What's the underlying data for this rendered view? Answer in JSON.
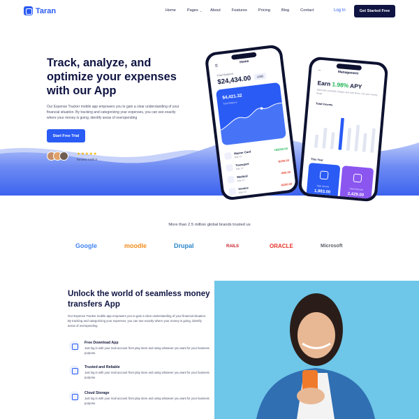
{
  "nav": {
    "brand": "Taran",
    "links": [
      "Home",
      "Pages",
      "About",
      "Features",
      "Pricing",
      "Blog",
      "Contact"
    ],
    "login": "Log In",
    "cta": "Get Started Free"
  },
  "hero": {
    "title": "Track, analyze, and optimize your expenses with our App",
    "description": "Our Expense Tracker mobile app empowers you to gain a clear understanding of your financial situation. By tracking and categorizing your expenses, you can see exactly where your money is going, identify areas of overspending",
    "button": "Start Free Trial",
    "stars": "★★★★★",
    "review": "Review 4.8/5.0"
  },
  "phone1": {
    "title": "Home",
    "total_label": "Total Balance",
    "balance": "$24,434.00",
    "currency": "USD",
    "card_value": "$4,421.32",
    "card_label": "Total Balance",
    "transactions": [
      {
        "name": "Master Card",
        "sub": "Mar 12",
        "amount": "+$2000.00",
        "color": "#1fb554"
      },
      {
        "name": "Transport",
        "sub": "Mar 12",
        "amount": "-$190.00",
        "color": "#e5412d"
      },
      {
        "name": "Medical",
        "sub": "Mar 11",
        "amount": "-$50.00",
        "color": "#e5412d"
      },
      {
        "name": "Invoice",
        "sub": "Mar 10",
        "amount": "-$200.00",
        "color": "#e5412d"
      }
    ]
  },
  "phone2": {
    "title": "Management",
    "earn_prefix": "Earn ",
    "earn_rate": "1.98%",
    "earn_suffix": " APY",
    "earn_sub": "Eliminate overdraft charges and wait times. Get your money faster.",
    "income_label": "Total Income",
    "income_range": "This Year",
    "bars": [
      0.35,
      0.55,
      0.45,
      0.85,
      0.6,
      0.7,
      0.5,
      0.65
    ],
    "box1_label": "Total Income",
    "box1_value": "1,983.00",
    "box2_label": "Total Expense",
    "box2_value": "2,429.00"
  },
  "brands": {
    "title": "More than 2.5 million global brands trusted us",
    "items": [
      "Google",
      "moodle",
      "Drupal",
      "RAILS",
      "ORACLE",
      "Microsoft"
    ]
  },
  "features": {
    "title": "Unlock the world of seamless money transfers App",
    "description": "Our Expense Tracker mobile app empowers you to gain a clear understanding of your financial situation. By tracking and categorizing your expenses, you can see exactly where your money is going, identify areas of overspending",
    "items": [
      {
        "title": "Free Download App",
        "desc": "Just log in with your mail account from play store and using whatever you want for your business purpose."
      },
      {
        "title": "Trusted and Reliable",
        "desc": "Just log in with your mail account from play store and using whatever you want for your business purpose."
      },
      {
        "title": "Cloud Storage",
        "desc": "Just log in with your mail account from play store and using whatever you want for your business purpose."
      }
    ]
  },
  "colors": {
    "primary": "#2a5bf5",
    "dark": "#0f1442",
    "positive": "#1fb554",
    "negative": "#e5412d",
    "photo_bg": "#6ec6e8"
  }
}
